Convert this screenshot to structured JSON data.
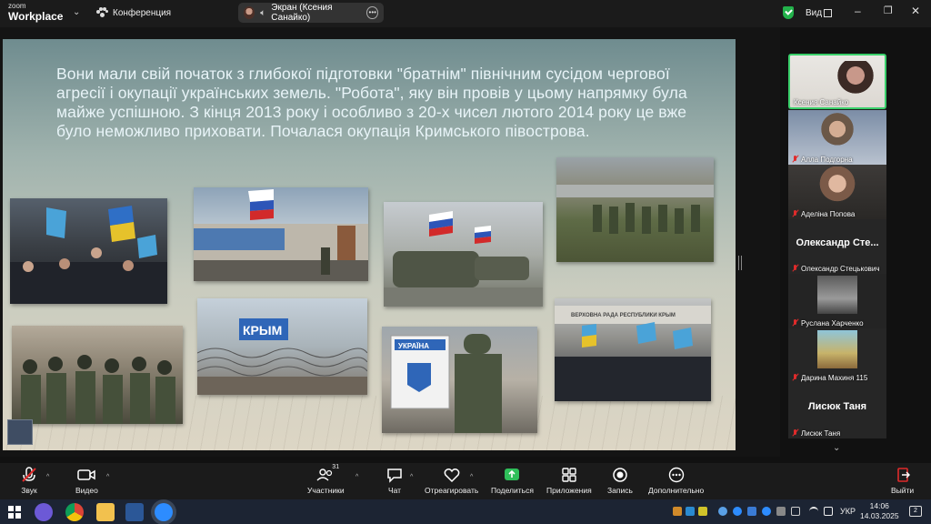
{
  "app": {
    "brand_small": "zoom",
    "brand_big": "Workplace",
    "meeting_label": "Конференция"
  },
  "share": {
    "label": "Экран (Ксения Санайко)"
  },
  "header": {
    "view_label": "Вид"
  },
  "slide": {
    "text": "Вони мали свій початок з глибокої підготовки \"братнім\" північним сусідом чергової агресії і окупації українських земель. \"Робота\", яку він провів у цьому напрямку була майже успішною. З кінця 2013 року і особливо з 20-х чисел лютого 2014 року це вже було неможливо приховати. Почалася окупація Кримського півострова.",
    "sign_krym": "КРЫМ",
    "sign_ukraina": "УКРАЇНА",
    "sign_rada": "ВЕРХОВНА РАДА РЕСПУБЛИКИ КРЫМ"
  },
  "participants": [
    {
      "name": "Ксения Санайко",
      "muted": false,
      "video": true,
      "active": true
    },
    {
      "name": "Алла Подгорна",
      "muted": true,
      "video": true
    },
    {
      "name": "Аделіна Попова",
      "muted": true,
      "video": true
    },
    {
      "name": "Олександр Стецькович",
      "display": "Олександр Сте...",
      "muted": true,
      "video": false
    },
    {
      "name": "Руслана Харченко",
      "muted": true,
      "video": true
    },
    {
      "name": "Дарина Махиня 115",
      "muted": true,
      "video": true
    },
    {
      "name": "Лисюк Таня",
      "display": "Лисюк Таня",
      "muted": true,
      "video": false
    }
  ],
  "toolbar": {
    "mute": "Звук",
    "video": "Видео",
    "participants": "Участники",
    "participants_count": "31",
    "chat": "Чат",
    "react": "Отреагировать",
    "share": "Поделиться",
    "apps": "Приложения",
    "record": "Запись",
    "more": "Дополнительно",
    "leave": "Выйти"
  },
  "taskbar": {
    "lang": "УКР",
    "time": "14:06",
    "date": "14.03.2025",
    "notif_count": "2"
  },
  "colors": {
    "accent_green": "#23b24b",
    "muted_red": "#e02b2b",
    "share_green": "#2fbf5a",
    "leave_red": "#e02b2b"
  }
}
